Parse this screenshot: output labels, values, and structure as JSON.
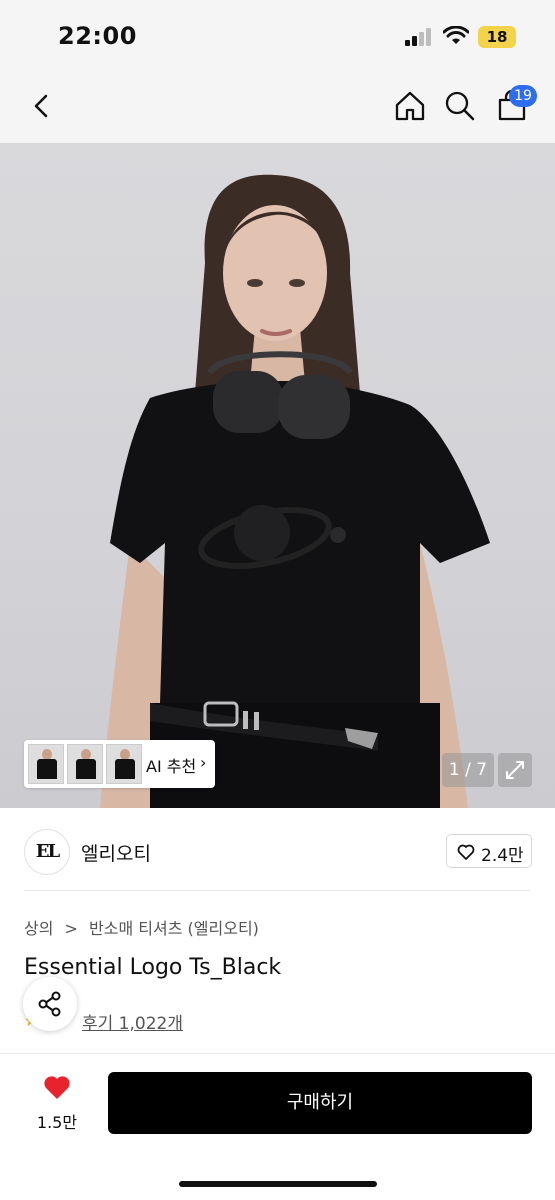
{
  "status_bar": {
    "time": "22:00",
    "battery": "18"
  },
  "nav": {
    "back_icon": "chevron-left-icon",
    "home_icon": "home-icon",
    "search_icon": "search-icon",
    "cart_icon": "shopping-bag-icon",
    "cart_count": "19"
  },
  "gallery": {
    "current_index": 1,
    "total": 7,
    "counter_text": "1 / 7",
    "ai_recommend_label": "AI 추천",
    "ai_chevron": "›",
    "expand_icon": "expand-icon"
  },
  "brand": {
    "logo_text": "EL",
    "name": "엘리오티",
    "like_count": "2.4만"
  },
  "product": {
    "breadcrumb": [
      "상의",
      "반소매 티셔츠 (엘리오티)"
    ],
    "breadcrumb_separator": ">",
    "title": "Essential Logo Ts_Black",
    "review_text": "후기 1,022개",
    "share_icon": "share-icon"
  },
  "bottom_bar": {
    "wish_count": "1.5만",
    "buy_label": "구매하기"
  },
  "colors": {
    "accent_badge": "#2f6df0",
    "wish_heart": "#e8232e",
    "buy_button": "#000000",
    "battery": "#f3d34a"
  }
}
